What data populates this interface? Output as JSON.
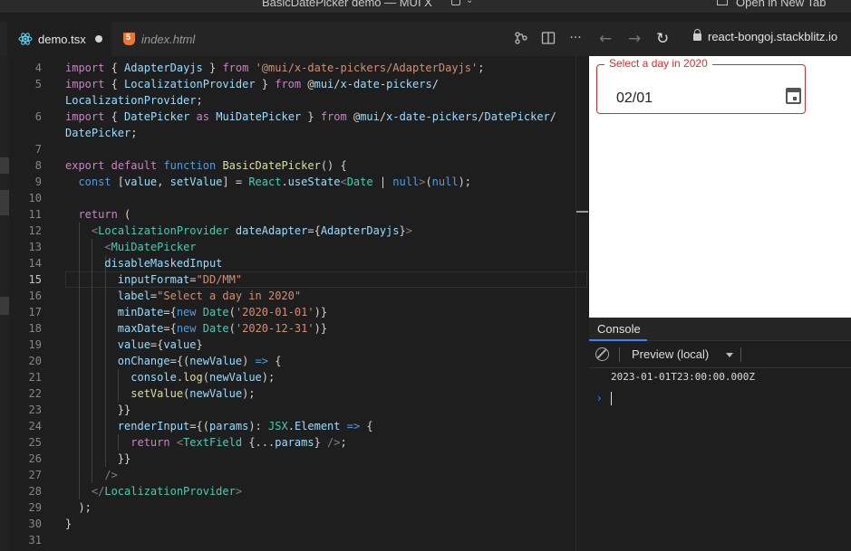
{
  "window": {
    "title": "BasicDatePicker demo — MUI X",
    "open_new_tab_label": "Open in New Tab"
  },
  "tabs": [
    {
      "label": "demo.tsx",
      "icon": "react-icon",
      "active": true,
      "dirty": true
    },
    {
      "label": "index.html",
      "icon": "html5-icon",
      "active": false
    }
  ],
  "editor_actions": [
    "split-diff-icon",
    "split-editor-icon",
    "more-actions-icon"
  ],
  "browser": {
    "url": "react-bongoj.stackblitz.io",
    "back_icon": "arrow-left-icon",
    "forward_icon": "arrow-right-icon",
    "reload_icon": "reload-icon"
  },
  "editor": {
    "current_line": 15,
    "lines": [
      {
        "n": 4,
        "text": "import { AdapterDayjs } from '@mui/x-date-pickers/AdapterDayjs';"
      },
      {
        "n": 5,
        "text": "import { LocalizationProvider } from '@mui/x-date-pickers/"
      },
      {
        "n": "",
        "text": "LocalizationProvider';"
      },
      {
        "n": 6,
        "text": "import { DatePicker as MuiDatePicker } from '@mui/x-date-pickers/DatePicker/"
      },
      {
        "n": "",
        "text": "DatePicker';"
      },
      {
        "n": 7,
        "text": ""
      },
      {
        "n": 8,
        "text": "export default function BasicDatePicker() {"
      },
      {
        "n": 9,
        "text": "  const [value, setValue] = React.useState<Date | null>(null);"
      },
      {
        "n": 10,
        "text": ""
      },
      {
        "n": 11,
        "text": "  return ("
      },
      {
        "n": 12,
        "text": "    <LocalizationProvider dateAdapter={AdapterDayjs}>"
      },
      {
        "n": 13,
        "text": "      <MuiDatePicker"
      },
      {
        "n": 14,
        "text": "      disableMaskedInput"
      },
      {
        "n": 15,
        "text": "        inputFormat=\"DD/MM\""
      },
      {
        "n": 16,
        "text": "        label=\"Select a day in 2020\""
      },
      {
        "n": 17,
        "text": "        minDate={new Date('2020-01-01')}"
      },
      {
        "n": 18,
        "text": "        maxDate={new Date('2020-12-31')}"
      },
      {
        "n": 19,
        "text": "        value={value}"
      },
      {
        "n": 20,
        "text": "        onChange={(newValue) => {"
      },
      {
        "n": 21,
        "text": "          console.log(newValue);"
      },
      {
        "n": 22,
        "text": "          setValue(newValue);"
      },
      {
        "n": 23,
        "text": "        }}"
      },
      {
        "n": 24,
        "text": "        renderInput={(params): JSX.Element => {"
      },
      {
        "n": 25,
        "text": "          return <TextField {...params} />;"
      },
      {
        "n": 26,
        "text": "        }}"
      },
      {
        "n": 27,
        "text": "      />"
      },
      {
        "n": 28,
        "text": "    </LocalizationProvider>"
      },
      {
        "n": 29,
        "text": "  );"
      },
      {
        "n": 30,
        "text": "}"
      },
      {
        "n": 31,
        "text": ""
      }
    ]
  },
  "preview": {
    "date_field": {
      "label": "Select a day in 2020",
      "value": "02/01",
      "error": true,
      "error_color": "#d32f2f",
      "icon": "calendar-icon"
    }
  },
  "console": {
    "tab_label": "Console",
    "context": "Preview (local)",
    "logs": [
      "2023-01-01T23:00:00.000Z"
    ],
    "prompt": "›"
  }
}
